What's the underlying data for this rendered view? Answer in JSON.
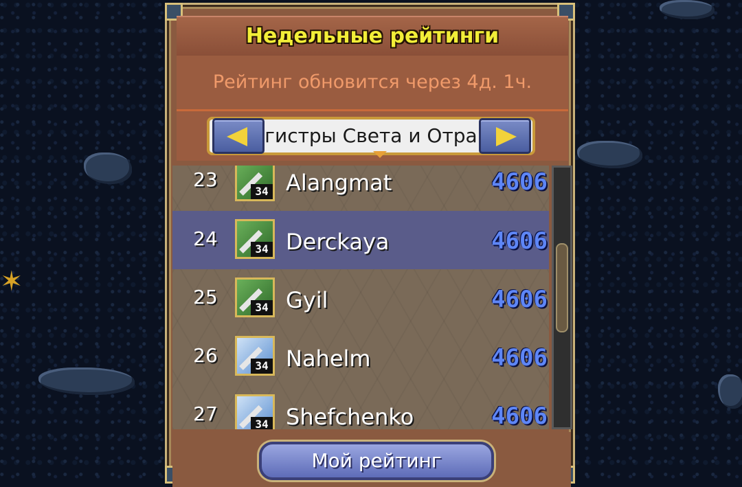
{
  "window": {
    "title": "Недельные рейтинги"
  },
  "refresh": {
    "text": "Рейтинг обновится через 4д. 1ч."
  },
  "selector": {
    "visible_text": "гистры Света и Отра",
    "prev_icon": "arrow-left-icon",
    "next_icon": "arrow-right-icon"
  },
  "rows": [
    {
      "rank": "23",
      "name": "Alangmat",
      "level": "34",
      "score": "4606",
      "avatar": "green-weapon-icon",
      "highlight": false
    },
    {
      "rank": "24",
      "name": "Derckaya",
      "level": "34",
      "score": "4606",
      "avatar": "green-bow-icon",
      "highlight": true
    },
    {
      "rank": "25",
      "name": "Gyil",
      "level": "34",
      "score": "4606",
      "avatar": "green-claws-icon",
      "highlight": false
    },
    {
      "rank": "26",
      "name": "Nahelm",
      "level": "34",
      "score": "4606",
      "avatar": "blue-orb-icon",
      "highlight": false
    },
    {
      "rank": "27",
      "name": "Shefchenko",
      "level": "34",
      "score": "4606",
      "avatar": "blue-staff-icon",
      "highlight": false
    }
  ],
  "footer": {
    "my_rating_label": "Мой рейтинг"
  },
  "colors": {
    "title": "#f2ee38",
    "refresh": "#f09a6a",
    "score": "#5e86f6",
    "highlight_row": "#5a5c8a"
  }
}
